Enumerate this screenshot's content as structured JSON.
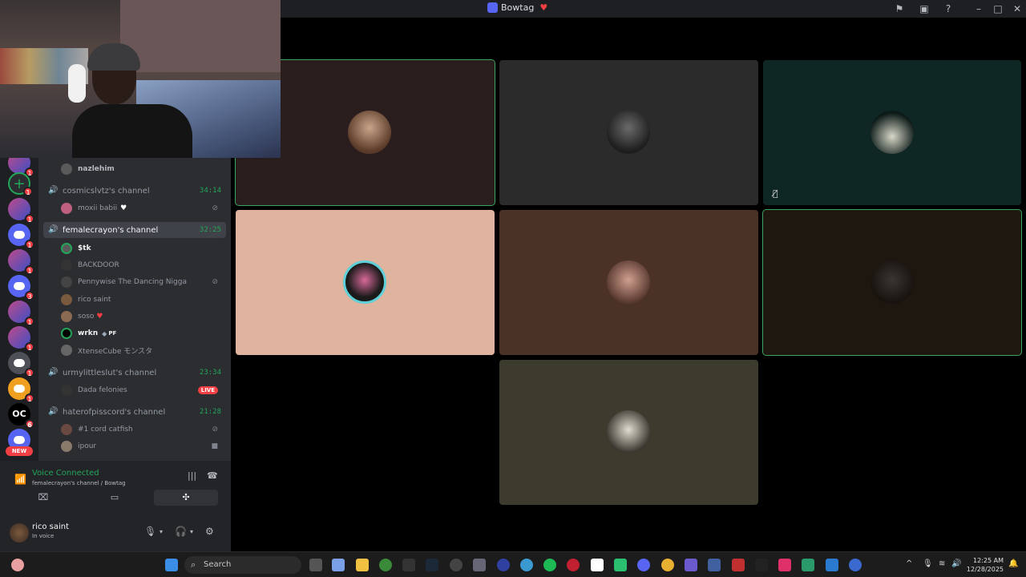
{
  "window": {
    "title": "Bowtag"
  },
  "servers": [
    {
      "badge": "1"
    },
    {
      "badge": "1"
    },
    {
      "badge": "1"
    },
    {
      "badge": "1"
    },
    {
      "badge": "1"
    },
    {
      "badge": "3"
    },
    {
      "badge": "1"
    },
    {
      "badge": "1"
    },
    {
      "badge": "1"
    },
    {
      "badge": "1"
    },
    {
      "label": "OC",
      "badge": "6"
    },
    {
      "badge": "NEW"
    }
  ],
  "channels": {
    "top_user": "nazlehim",
    "list": [
      {
        "name": "cosmicslvtz's channel",
        "time": "34:14",
        "users": [
          {
            "name": "moxii babii"
          }
        ]
      },
      {
        "name": "femalecrayon's channel",
        "time": "32:25",
        "users": [
          {
            "name": "$tk"
          },
          {
            "name": "BACKDOOR"
          },
          {
            "name": "Pennywise The Dancing Nigga"
          },
          {
            "name": "rico saint"
          },
          {
            "name": "soso"
          },
          {
            "name": "wrkn",
            "tag": "PF"
          },
          {
            "name": "XtenseCube モンスタ"
          }
        ]
      },
      {
        "name": "urmylittleslut's channel",
        "time": "23:34",
        "users": [
          {
            "name": "Dada felonies",
            "live": "LIVE"
          }
        ]
      },
      {
        "name": "haterofpisscord's channel",
        "time": "21:28",
        "users": [
          {
            "name": "#1 cord catfish"
          },
          {
            "name": "ipour"
          }
        ]
      }
    ]
  },
  "voice": {
    "status": "Voice Connected",
    "location": "femalecrayon's channel / Bowtag"
  },
  "user": {
    "name": "rico saint",
    "status": "In voice"
  },
  "taskbar": {
    "search_placeholder": "Search",
    "time": "12:25 AM",
    "date": "12/28/2025"
  },
  "colors": {
    "accent_green": "#23a559",
    "danger_red": "#f23f43",
    "blurple": "#5865f2"
  }
}
